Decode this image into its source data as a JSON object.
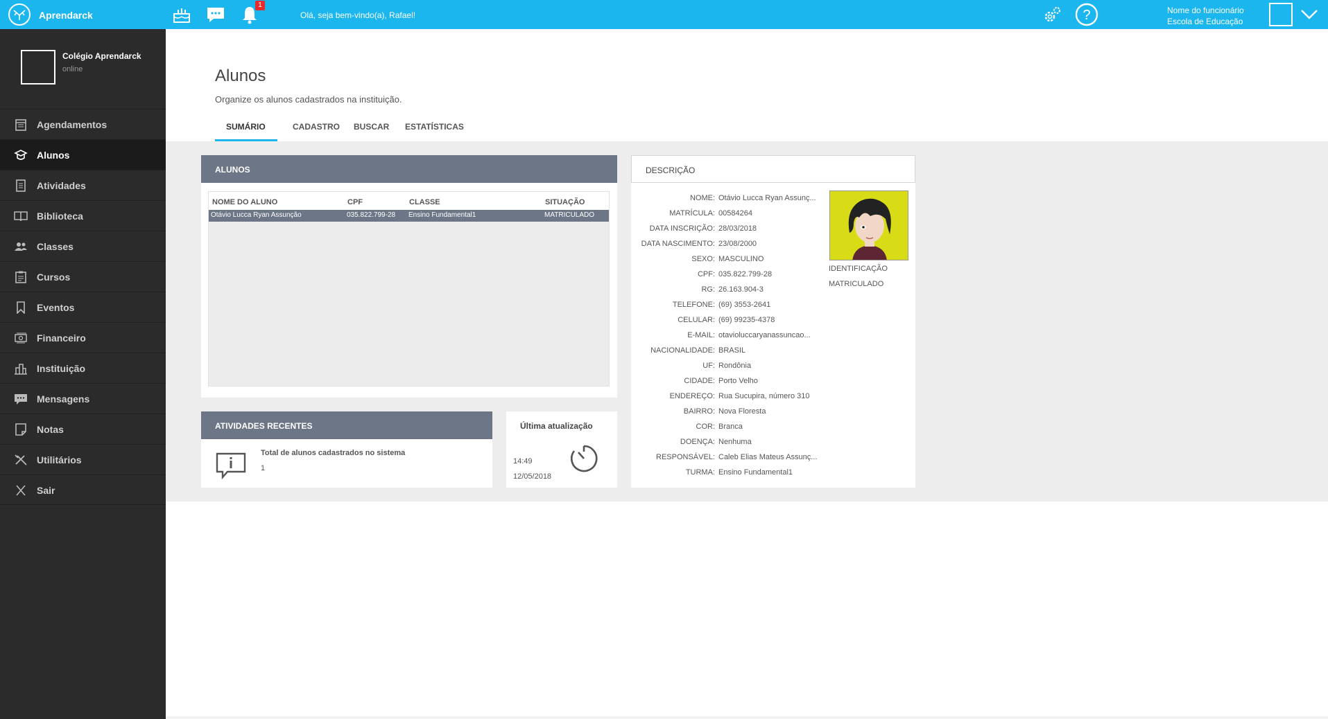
{
  "app": {
    "name": "Aprendarck",
    "welcome": "Olá, seja bem-vindo(a), Rafael!",
    "notification_count": "1",
    "user_role": "Nome do funcionário",
    "user_school": "Escola de Educação"
  },
  "sidebar": {
    "school_name": "Colégio Aprendarck",
    "status": "online",
    "items": [
      {
        "label": "Agendamentos",
        "icon": "calendar-icon"
      },
      {
        "label": "Alunos",
        "icon": "graduation-cap-icon",
        "active": true
      },
      {
        "label": "Atividades",
        "icon": "document-icon"
      },
      {
        "label": "Biblioteca",
        "icon": "book-icon"
      },
      {
        "label": "Classes",
        "icon": "people-icon"
      },
      {
        "label": "Cursos",
        "icon": "clipboard-icon"
      },
      {
        "label": "Eventos",
        "icon": "bookmark-icon"
      },
      {
        "label": "Financeiro",
        "icon": "money-icon"
      },
      {
        "label": "Instituição",
        "icon": "building-icon"
      },
      {
        "label": "Mensagens",
        "icon": "chat-icon"
      },
      {
        "label": "Notas",
        "icon": "note-icon"
      },
      {
        "label": "Utilitários",
        "icon": "tools-icon"
      },
      {
        "label": "Sair",
        "icon": "close-icon"
      }
    ]
  },
  "page": {
    "title": "Alunos",
    "subtitle": "Organize os alunos cadastrados na instituição.",
    "tabs": [
      "SUMÁRIO",
      "CADASTRO",
      "BUSCAR",
      "ESTATÍSTICAS"
    ]
  },
  "students_panel": {
    "title": "ALUNOS",
    "columns": [
      "NOME DO ALUNO",
      "CPF",
      "CLASSE",
      "SITUAÇÃO"
    ],
    "rows": [
      [
        "Otávio Lucca Ryan Assunção",
        "035.822.799-28",
        "Ensino Fundamental1",
        "MATRICULADO"
      ]
    ]
  },
  "description_panel": {
    "title": "DESCRIÇÃO",
    "fields": [
      {
        "label": "NOME:",
        "value": "Otávio Lucca Ryan Assunç..."
      },
      {
        "label": "MATRÍCULA:",
        "value": "00584264"
      },
      {
        "label": "DATA INSCRIÇÃO:",
        "value": "28/03/2018"
      },
      {
        "label": "DATA NASCIMENTO:",
        "value": "23/08/2000"
      },
      {
        "label": "SEXO:",
        "value": "MASCULINO"
      },
      {
        "label": "CPF:",
        "value": "035.822.799-28"
      },
      {
        "label": "RG:",
        "value": "26.163.904-3"
      },
      {
        "label": "TELEFONE:",
        "value": "(69) 3553-2641"
      },
      {
        "label": "CELULAR:",
        "value": "(69) 99235-4378"
      },
      {
        "label": "E-MAIL:",
        "value": "otavioluccaryanassuncao..."
      },
      {
        "label": "NACIONALIDADE:",
        "value": "BRASIL"
      },
      {
        "label": "UF:",
        "value": "Rondônia"
      },
      {
        "label": "CIDADE:",
        "value": "Porto Velho"
      },
      {
        "label": "ENDEREÇO:",
        "value": "Rua Sucupira, número 310"
      },
      {
        "label": "BAIRRO:",
        "value": "Nova Floresta"
      },
      {
        "label": "COR:",
        "value": "Branca"
      },
      {
        "label": "DOENÇA:",
        "value": "Nenhuma"
      },
      {
        "label": "RESPONSÁVEL:",
        "value": "Caleb Elias Mateus Assunç..."
      },
      {
        "label": "TURMA:",
        "value": "Ensino Fundamental1"
      }
    ],
    "photo_label": "IDENTIFICAÇÃO",
    "photo_status": "MATRICULADO"
  },
  "activities_panel": {
    "title": "ATIVIDADES RECENTES",
    "item_title": "Total de alunos cadastrados no sistema",
    "item_value": "1"
  },
  "update_panel": {
    "title": "Última atualização",
    "time": "14:49",
    "date": "12/05/2018"
  },
  "colors": {
    "topbar": "#1cb6ef",
    "sidebar": "#2b2b2b",
    "panel_header": "#6d7686"
  }
}
